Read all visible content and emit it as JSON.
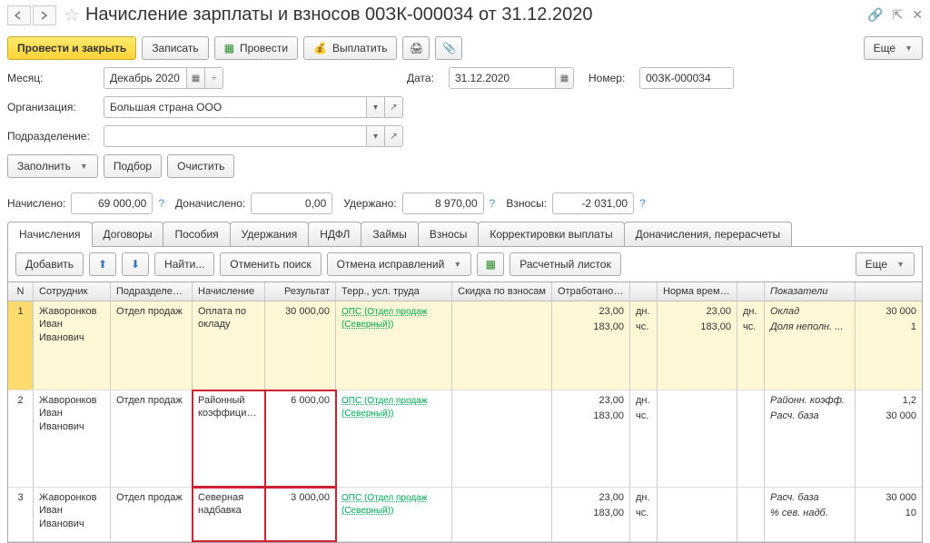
{
  "title": "Начисление зарплаты и взносов 00ЗК-000034 от 31.12.2020",
  "toolbar": {
    "post_close": "Провести и закрыть",
    "save": "Записать",
    "post": "Провести",
    "pay": "Выплатить",
    "more": "Еще"
  },
  "form": {
    "month_lbl": "Месяц:",
    "month_val": "Декабрь 2020",
    "date_lbl": "Дата:",
    "date_val": "31.12.2020",
    "number_lbl": "Номер:",
    "number_val": "00ЗК-000034",
    "org_lbl": "Организация:",
    "org_val": "Большая страна ООО",
    "dept_lbl": "Подразделение:",
    "dept_val": ""
  },
  "actions": {
    "fill": "Заполнить",
    "select": "Подбор",
    "clear": "Очистить"
  },
  "totals": {
    "accrued_lbl": "Начислено:",
    "accrued_val": "69 000,00",
    "addl_lbl": "Доначислено:",
    "addl_val": "0,00",
    "withheld_lbl": "Удержано:",
    "withheld_val": "8 970,00",
    "contrib_lbl": "Взносы:",
    "contrib_val": "-2 031,00"
  },
  "tabs": [
    "Начисления",
    "Договоры",
    "Пособия",
    "Удержания",
    "НДФЛ",
    "Займы",
    "Взносы",
    "Корректировки выплаты",
    "Доначисления, перерасчеты"
  ],
  "tabtoolbar": {
    "add": "Добавить",
    "find": "Найти...",
    "cancel_search": "Отменить поиск",
    "cancel_fix": "Отмена исправлений",
    "payslip": "Расчетный листок",
    "more": "Еще"
  },
  "grid": {
    "headers": {
      "n": "N",
      "emp": "Сотрудник",
      "dept": "Подразделение",
      "accr": "Начисление",
      "res": "Результат",
      "terr": "Терр., усл. труда",
      "disc": "Скидка по взносам",
      "work": "Отработано ...",
      "norm": "Норма времени",
      "ind": "Показатели"
    },
    "rows": [
      {
        "n": "1",
        "emp": "Жаворонков Иван Иванович",
        "dept": "Отдел продаж",
        "accr": "Оплата по окладу",
        "res": "30 000,00",
        "terr": "ОПС (Отдел продаж (Северный))",
        "work_d": "23,00",
        "work_du": "дн.",
        "work_h": "183,00",
        "work_hu": "чс.",
        "norm_d": "23,00",
        "norm_du": "дн.",
        "norm_h": "183,00",
        "norm_hu": "чс.",
        "ind1_n": "Оклад",
        "ind1_v": "30 000",
        "ind2_n": "Доля неполн. ...",
        "ind2_v": "1"
      },
      {
        "n": "2",
        "emp": "Жаворонков Иван Иванович",
        "dept": "Отдел продаж",
        "accr": "Районный коэффициент",
        "res": "6 000,00",
        "terr": "ОПС (Отдел продаж (Северный))",
        "work_d": "23,00",
        "work_du": "дн.",
        "work_h": "183,00",
        "work_hu": "чс.",
        "norm_d": "",
        "norm_du": "",
        "norm_h": "",
        "norm_hu": "",
        "ind1_n": "Районн. коэфф.",
        "ind1_v": "1,2",
        "ind2_n": "Расч. база",
        "ind2_v": "30 000"
      },
      {
        "n": "3",
        "emp": "Жаворонков Иван Иванович",
        "dept": "Отдел продаж",
        "accr": "Северная надбавка",
        "res": "3 000,00",
        "terr": "ОПС (Отдел продаж (Северный))",
        "work_d": "23,00",
        "work_du": "дн.",
        "work_h": "183,00",
        "work_hu": "чс.",
        "norm_d": "",
        "norm_du": "",
        "norm_h": "",
        "norm_hu": "",
        "ind1_n": "Расч. база",
        "ind1_v": "30 000",
        "ind2_n": "% сев. надб.",
        "ind2_v": "10"
      }
    ]
  }
}
